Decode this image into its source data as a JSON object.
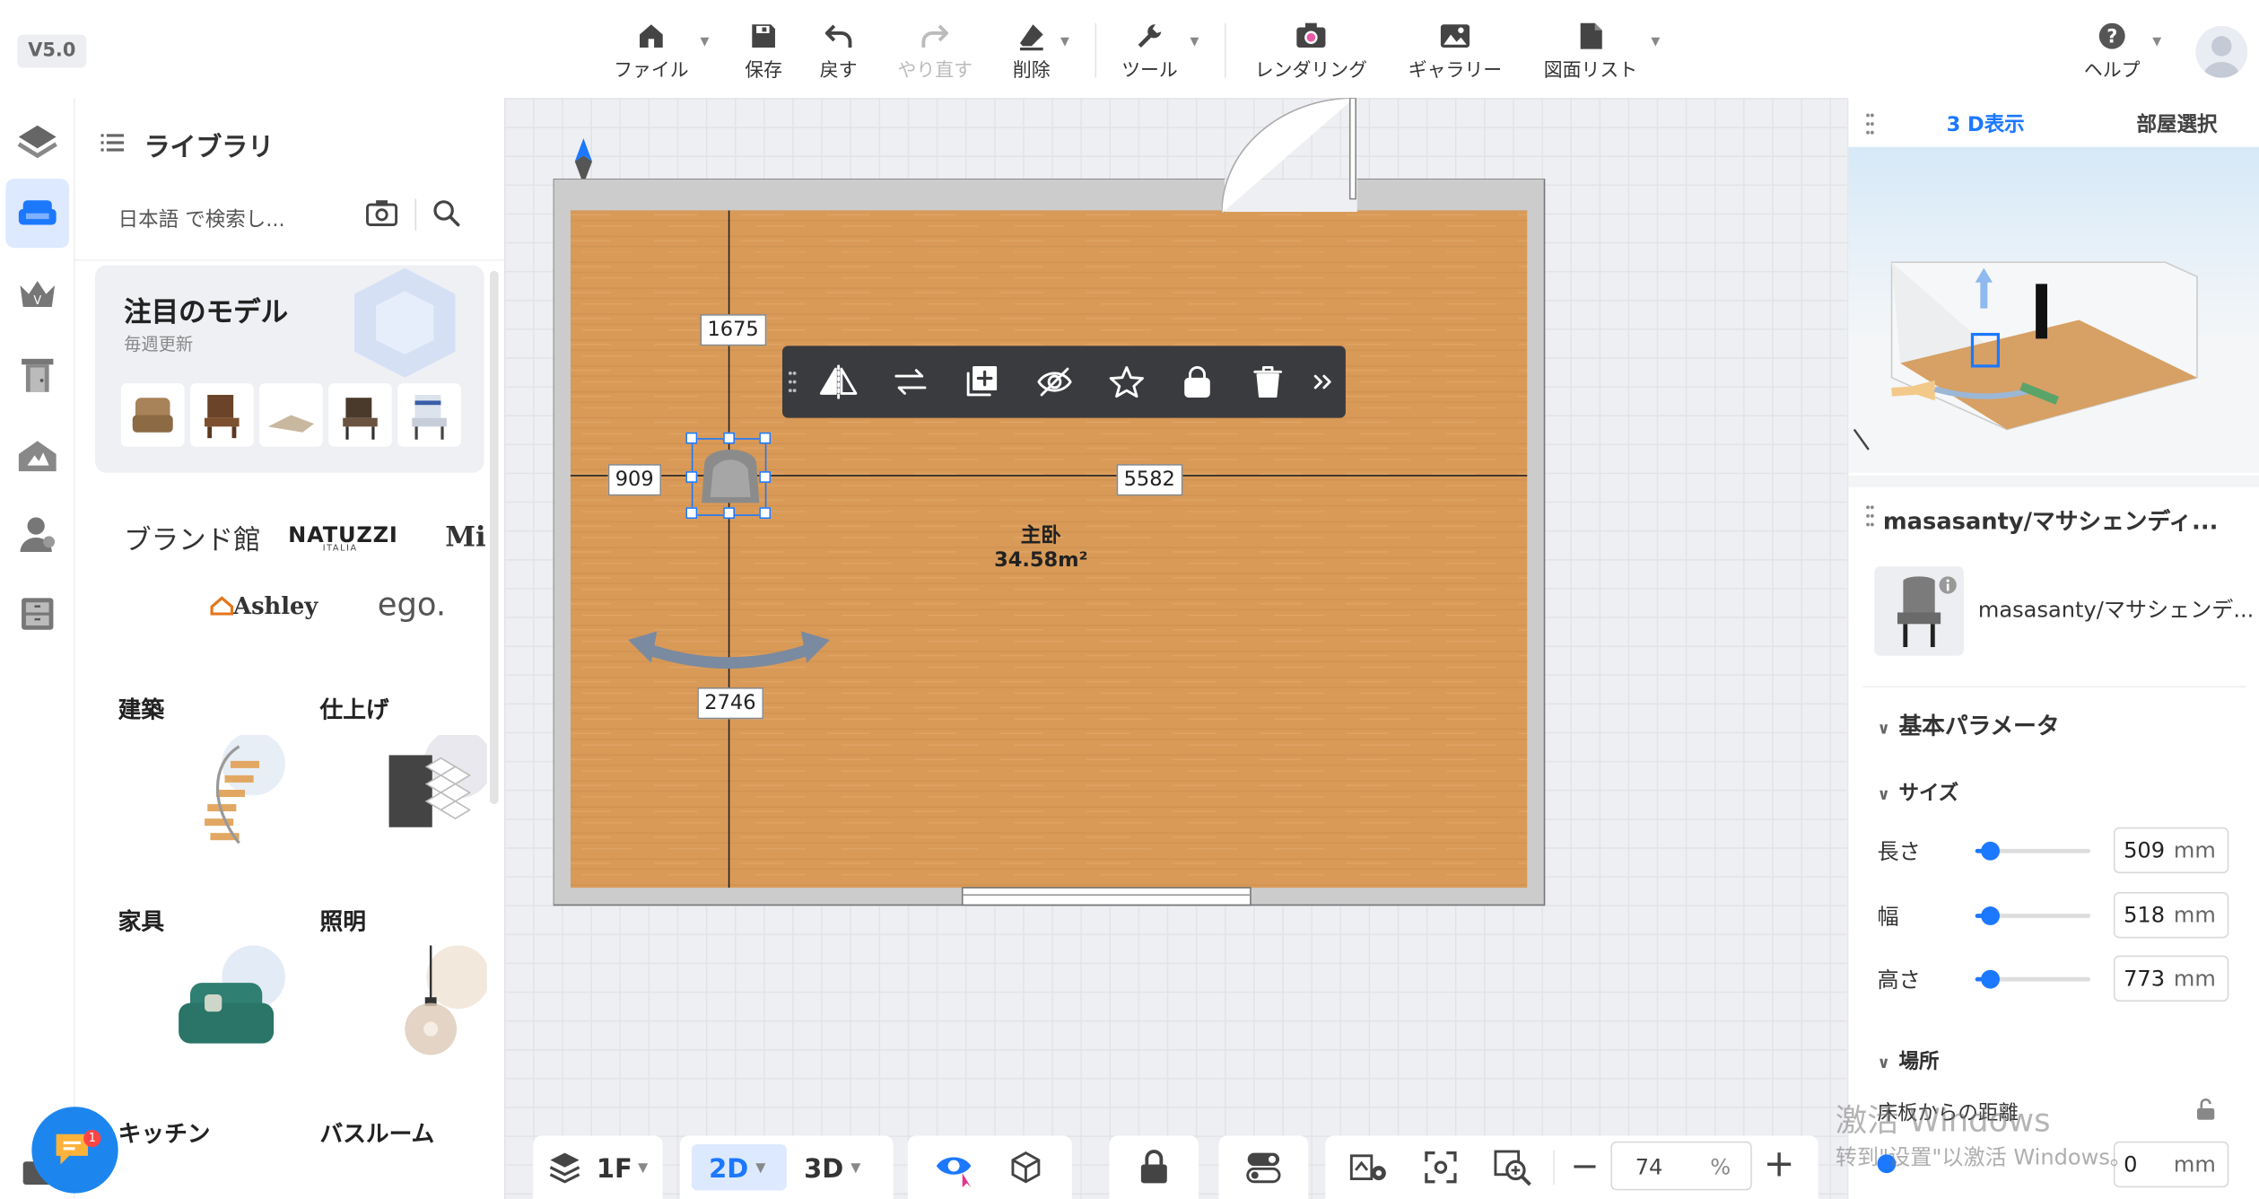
{
  "app": {
    "version": "V5.0"
  },
  "toolbar": {
    "file": "ファイル",
    "save": "保存",
    "undo": "戻す",
    "redo": "やり直す",
    "delete": "削除",
    "tools": "ツール",
    "rendering": "レンダリング",
    "gallery": "ギャラリー",
    "drawing_list": "図面リスト",
    "help": "ヘルプ"
  },
  "sidebar_icons": [
    "layers-icon",
    "sofa-icon",
    "crown-icon",
    "door-icon",
    "house-icon",
    "user-icon",
    "cabinet-icon",
    "catalog-icon"
  ],
  "library": {
    "title": "ライブラリ",
    "search_placeholder": "日本語 で検索し...",
    "featured_title": "注目のモデル",
    "featured_subtitle": "毎週更新",
    "brand_label": "ブランド館",
    "brands": [
      "NATUZZI",
      "ITALIA",
      "Mi",
      "Ashley",
      "ego."
    ],
    "categories": [
      "建築",
      "仕上げ",
      "家具",
      "照明",
      "キッチン",
      "バスルーム"
    ],
    "chat_badge": "1"
  },
  "canvas": {
    "dim_top": "1675",
    "dim_left": "909",
    "dim_right": "5582",
    "dim_bottom": "2746",
    "room_name": "主卧",
    "room_area": "34.58m²",
    "context_actions": [
      "mirror-icon",
      "replace-icon",
      "duplicate-icon",
      "hide-icon",
      "favorite-icon",
      "lock-icon",
      "trash-icon",
      "more-icon"
    ]
  },
  "bottombar": {
    "floor": "1F",
    "mode_2d": "2D",
    "mode_3d": "3D",
    "zoom_value": "74",
    "zoom_unit": "%"
  },
  "rpanel": {
    "tab_3d": "3 D表示",
    "tab_room": "部屋選択",
    "item_title": "masasanty/マサシェンディ...",
    "item_name": "masasanty/マサシェンデ...",
    "basic_params": "基本パラメータ",
    "size_section": "サイズ",
    "length_label": "長さ",
    "length_value": "509",
    "width_label": "幅",
    "width_value": "518",
    "height_label": "高さ",
    "height_value": "773",
    "unit": "mm",
    "location_section": "場所",
    "floor_distance_label": "床板からの距離",
    "floor_distance_value": "0",
    "watermark_line1": "激活 Windows",
    "watermark_line2": "转到\"设置\"以激活 Windows。",
    "slider_length": 0.12,
    "slider_width": 0.12,
    "slider_height": 0.12
  },
  "colors": {
    "accent": "#1c78ff",
    "floor": "#d99a58",
    "toolbar_dark": "#3a3b3e"
  }
}
